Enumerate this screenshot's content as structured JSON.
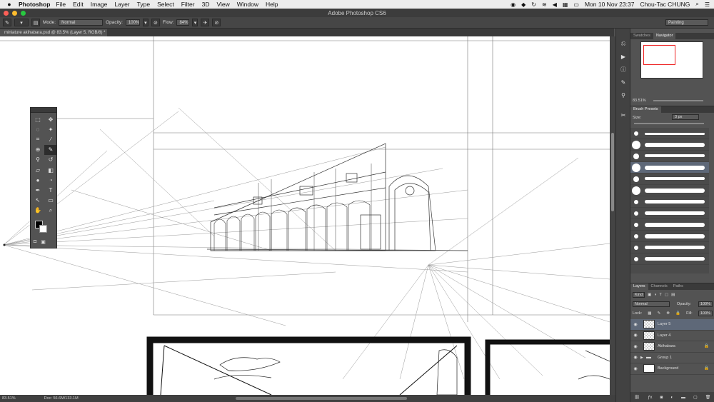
{
  "menubar": {
    "app": "Photoshop",
    "items": [
      "File",
      "Edit",
      "Image",
      "Layer",
      "Type",
      "Select",
      "Filter",
      "3D",
      "View",
      "Window",
      "Help"
    ],
    "clock": "Mon 10 Nov  23:37",
    "user": "Chou-Tac CHUNG"
  },
  "window": {
    "title": "Adobe Photoshop CS6"
  },
  "options": {
    "mode_label": "Mode:",
    "mode_value": "Normal",
    "opacity_label": "Opacity:",
    "opacity_value": "100%",
    "flow_label": "Flow:",
    "flow_value": "84%",
    "workspace": "Painting"
  },
  "document": {
    "tab": "miniature akihabara.psd @ 83.5% (Layer 5, RGB/8) *"
  },
  "status": {
    "zoom": "83.51%",
    "doc": "Doc: 56.6M/133.1M"
  },
  "navigator": {
    "tabs": [
      "Swatches",
      "Navigator"
    ],
    "zoom": "83.51%"
  },
  "brushes": {
    "tab": "Brush Presets",
    "size_label": "Size:",
    "size_value": "3 px"
  },
  "layers": {
    "tabs": [
      "Layers",
      "Channels",
      "Paths"
    ],
    "kind": "Kind",
    "blend": "Normal",
    "opacity_label": "Opacity:",
    "opacity_value": "100%",
    "lock_label": "Lock:",
    "fill_label": "Fill:",
    "fill_value": "100%",
    "items": [
      {
        "name": "Layer 5",
        "selected": true
      },
      {
        "name": "Layer 4",
        "selected": false
      },
      {
        "name": "Akihabara",
        "selected": false
      },
      {
        "name": "Group 1",
        "selected": false
      },
      {
        "name": "Background",
        "selected": false
      }
    ]
  },
  "colors": {
    "accent": "#5e6878",
    "navigator_box": "#e22222"
  }
}
